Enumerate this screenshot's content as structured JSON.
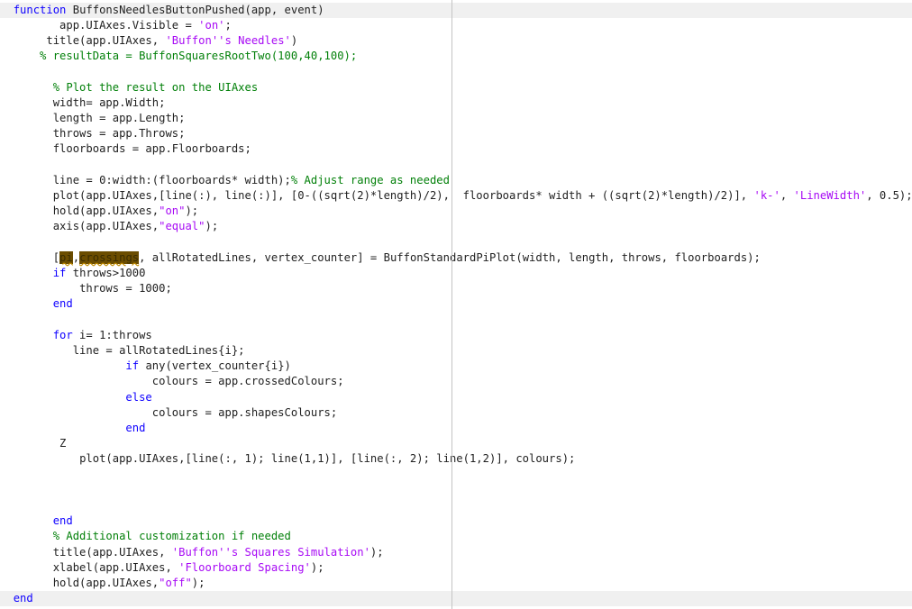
{
  "editor": {
    "language": "MATLAB",
    "colors": {
      "keyword": "#0e00ff",
      "string": "#a709f5",
      "comment": "#028009",
      "text": "#212121",
      "band_background": "#f0f0f0",
      "highlight": "#6b4d00"
    },
    "lines": [
      {
        "indent": "  ",
        "band": true,
        "tokens": [
          {
            "t": "kw",
            "v": "function"
          },
          {
            "t": "tx",
            "v": " BuffonsNeedlesButtonPushed(app, event)"
          }
        ]
      },
      {
        "indent": "         ",
        "tokens": [
          {
            "t": "tx",
            "v": "app.UIAxes.Visible = "
          },
          {
            "t": "str",
            "v": "'on'"
          },
          {
            "t": "tx",
            "v": ";"
          }
        ]
      },
      {
        "indent": "       ",
        "tokens": [
          {
            "t": "tx",
            "v": "title(app.UIAxes, "
          },
          {
            "t": "str",
            "v": "'Buffon''s Needles'"
          },
          {
            "t": "tx",
            "v": ")"
          }
        ]
      },
      {
        "indent": "      ",
        "tokens": [
          {
            "t": "cm",
            "v": "% resultData = BuffonSquaresRootTwo(100,40,100);"
          }
        ]
      },
      {
        "indent": "",
        "tokens": []
      },
      {
        "indent": "        ",
        "tokens": [
          {
            "t": "cm",
            "v": "% Plot the result on the UIAxes"
          }
        ]
      },
      {
        "indent": "        ",
        "tokens": [
          {
            "t": "tx",
            "v": "width= app.Width;"
          }
        ]
      },
      {
        "indent": "        ",
        "tokens": [
          {
            "t": "tx",
            "v": "length = app.Length;"
          }
        ]
      },
      {
        "indent": "        ",
        "tokens": [
          {
            "t": "tx",
            "v": "throws = app.Throws;"
          }
        ]
      },
      {
        "indent": "        ",
        "tokens": [
          {
            "t": "tx",
            "v": "floorboards = app.Floorboards;"
          }
        ]
      },
      {
        "indent": "",
        "tokens": []
      },
      {
        "indent": "        ",
        "tokens": [
          {
            "t": "tx",
            "v": "line = 0:width:(floorboards* width);"
          },
          {
            "t": "cm",
            "v": "% Adjust range as needed"
          }
        ]
      },
      {
        "indent": "        ",
        "tokens": [
          {
            "t": "tx",
            "v": "plot(app.UIAxes,[line(:), line(:)], [0-((sqrt(2)*length)/2),  floorboards* width + ((sqrt(2)*length)/2)], "
          },
          {
            "t": "str",
            "v": "'k-'"
          },
          {
            "t": "tx",
            "v": ", "
          },
          {
            "t": "str",
            "v": "'LineWidth'"
          },
          {
            "t": "tx",
            "v": ", 0.5);"
          }
        ]
      },
      {
        "indent": "        ",
        "tokens": [
          {
            "t": "tx",
            "v": "hold(app.UIAxes,"
          },
          {
            "t": "str",
            "v": "\"on\""
          },
          {
            "t": "tx",
            "v": ");"
          }
        ]
      },
      {
        "indent": "        ",
        "tokens": [
          {
            "t": "tx",
            "v": "axis(app.UIAxes,"
          },
          {
            "t": "str",
            "v": "\"equal\""
          },
          {
            "t": "tx",
            "v": ");"
          }
        ]
      },
      {
        "indent": "",
        "tokens": []
      },
      {
        "indent": "        ",
        "tokens": [
          {
            "t": "tx",
            "v": "["
          },
          {
            "t": "hl",
            "v": "pi"
          },
          {
            "t": "tx",
            "v": ","
          },
          {
            "t": "hl",
            "v": "crossings"
          },
          {
            "t": "tx",
            "v": ", allRotatedLines, vertex_counter] = BuffonStandardPiPlot(width, length, throws, floorboards);"
          }
        ]
      },
      {
        "indent": "        ",
        "tokens": [
          {
            "t": "kw",
            "v": "if"
          },
          {
            "t": "tx",
            "v": " throws>1000"
          }
        ]
      },
      {
        "indent": "            ",
        "tokens": [
          {
            "t": "tx",
            "v": "throws = 1000;"
          }
        ]
      },
      {
        "indent": "        ",
        "tokens": [
          {
            "t": "kw",
            "v": "end"
          }
        ]
      },
      {
        "indent": "",
        "tokens": []
      },
      {
        "indent": "        ",
        "tokens": [
          {
            "t": "kw",
            "v": "for"
          },
          {
            "t": "tx",
            "v": " i= 1:throws"
          }
        ]
      },
      {
        "indent": "           ",
        "tokens": [
          {
            "t": "tx",
            "v": "line = allRotatedLines{i};"
          }
        ]
      },
      {
        "indent": "                   ",
        "tokens": [
          {
            "t": "kw",
            "v": "if"
          },
          {
            "t": "tx",
            "v": " any(vertex_counter{i})"
          }
        ]
      },
      {
        "indent": "                       ",
        "tokens": [
          {
            "t": "tx",
            "v": "colours = app.crossedColours;"
          }
        ]
      },
      {
        "indent": "                   ",
        "tokens": [
          {
            "t": "kw",
            "v": "else"
          }
        ]
      },
      {
        "indent": "                       ",
        "tokens": [
          {
            "t": "tx",
            "v": "colours = app.shapesColours;"
          }
        ]
      },
      {
        "indent": "                   ",
        "tokens": [
          {
            "t": "kw",
            "v": "end"
          }
        ]
      },
      {
        "indent": "         ",
        "tokens": [
          {
            "t": "tx",
            "v": "Z"
          }
        ]
      },
      {
        "indent": "            ",
        "tokens": [
          {
            "t": "tx",
            "v": "plot(app.UIAxes,[line(:, 1); line(1,1)], [line(:, 2); line(1,2)], colours);"
          }
        ]
      },
      {
        "indent": "",
        "tokens": []
      },
      {
        "indent": "",
        "tokens": []
      },
      {
        "indent": "",
        "tokens": []
      },
      {
        "indent": "        ",
        "tokens": [
          {
            "t": "kw",
            "v": "end"
          }
        ]
      },
      {
        "indent": "        ",
        "tokens": [
          {
            "t": "cm",
            "v": "% Additional customization if needed"
          }
        ]
      },
      {
        "indent": "        ",
        "tokens": [
          {
            "t": "tx",
            "v": "title(app.UIAxes, "
          },
          {
            "t": "str",
            "v": "'Buffon''s Squares Simulation'"
          },
          {
            "t": "tx",
            "v": ");"
          }
        ]
      },
      {
        "indent": "        ",
        "tokens": [
          {
            "t": "tx",
            "v": "xlabel(app.UIAxes, "
          },
          {
            "t": "str",
            "v": "'Floorboard Spacing'"
          },
          {
            "t": "tx",
            "v": ");"
          }
        ]
      },
      {
        "indent": "        ",
        "tokens": [
          {
            "t": "tx",
            "v": "hold(app.UIAxes,"
          },
          {
            "t": "str",
            "v": "\"off\""
          },
          {
            "t": "tx",
            "v": ");"
          }
        ]
      },
      {
        "indent": "  ",
        "band": true,
        "tokens": [
          {
            "t": "kw",
            "v": "end"
          }
        ]
      }
    ]
  }
}
